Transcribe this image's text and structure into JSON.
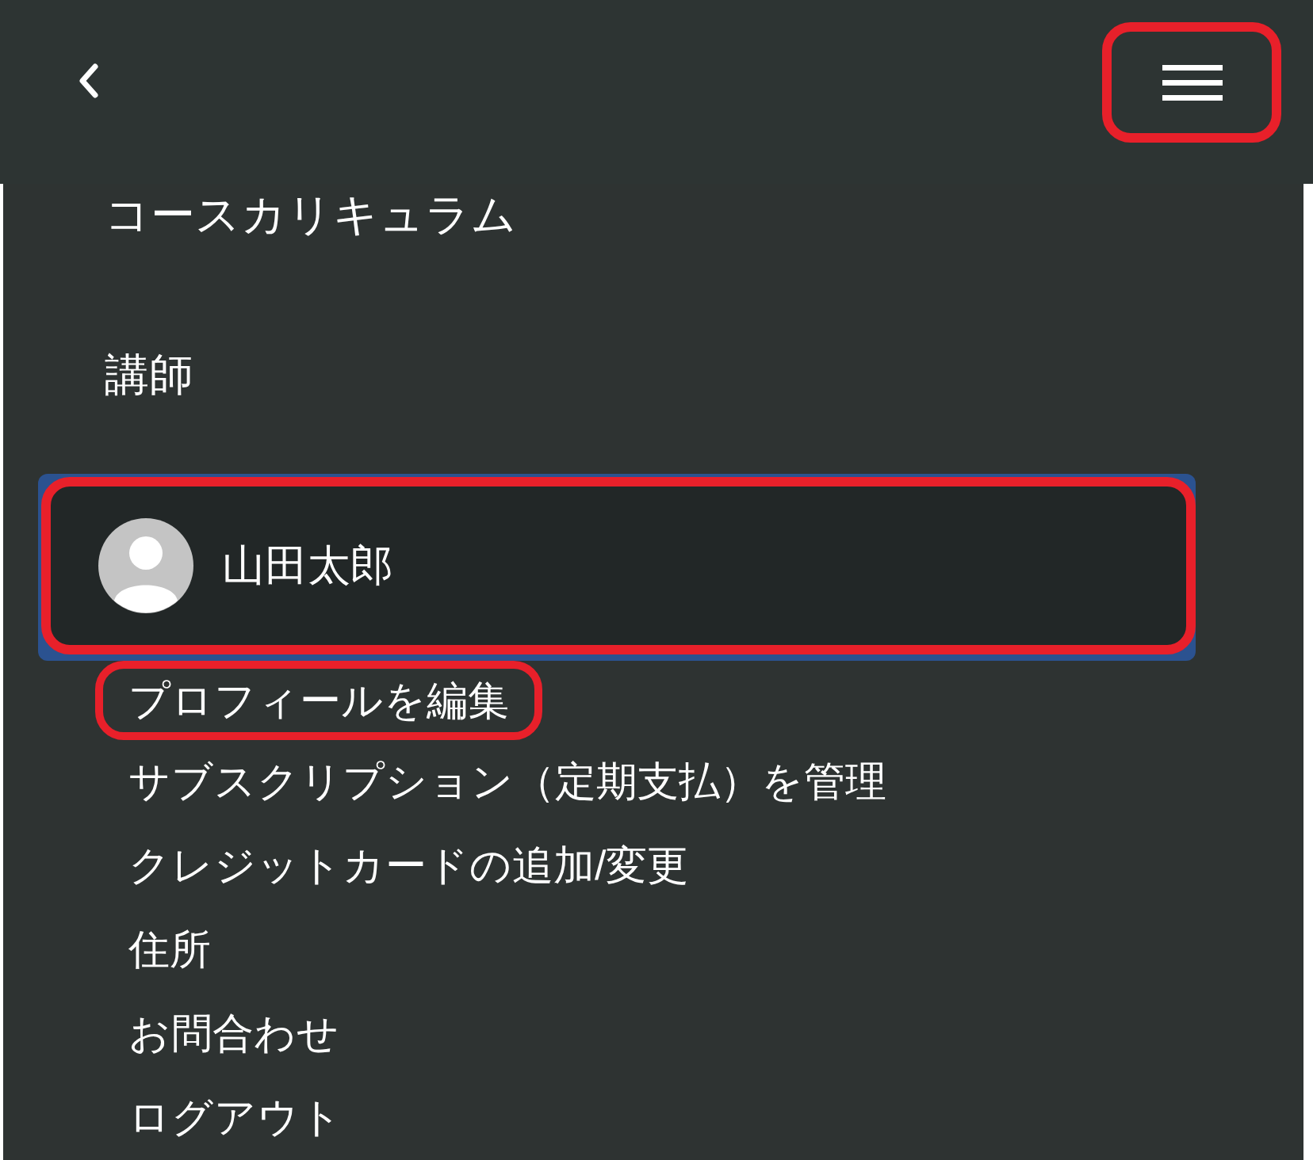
{
  "header": {
    "menu_button": {
      "highlighted": true
    }
  },
  "nav": [
    {
      "label": "コースカリキュラム"
    },
    {
      "label": "講師"
    }
  ],
  "user": {
    "name": "山田太郎",
    "highlighted": true
  },
  "user_menu": [
    {
      "label": "プロフィールを編集",
      "highlighted": true
    },
    {
      "label": "サブスクリプション（定期支払）を管理",
      "highlighted": false
    },
    {
      "label": "クレジットカードの追加/変更",
      "highlighted": false
    },
    {
      "label": "住所",
      "highlighted": false
    },
    {
      "label": "お問合わせ",
      "highlighted": false
    },
    {
      "label": "ログアウト",
      "highlighted": false
    }
  ]
}
